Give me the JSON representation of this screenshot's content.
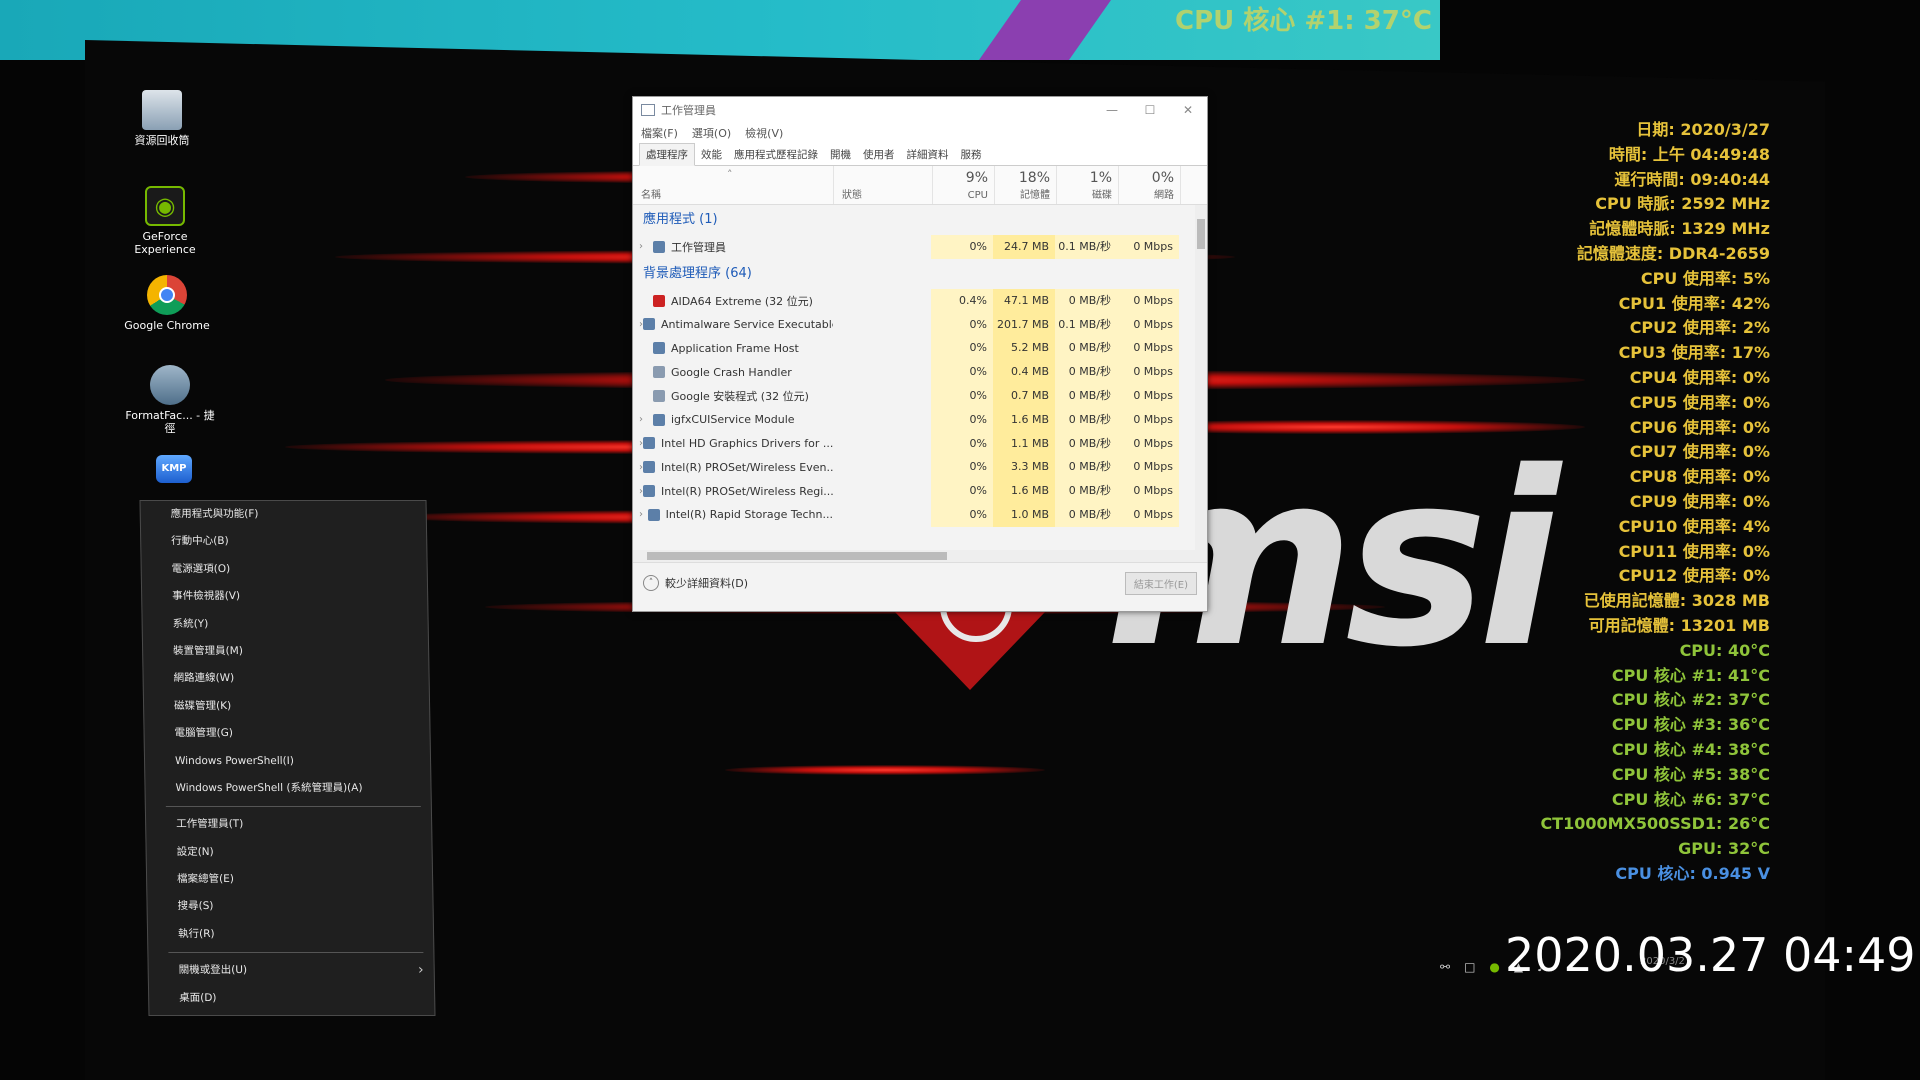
{
  "background_monitor": {
    "text": "CPU 核心 #1: 37°C"
  },
  "desktop_icons": [
    {
      "label": "資源回收筒",
      "icon": "recycle-bin-icon"
    },
    {
      "label": "GeForce Experience",
      "icon": "nvidia-icon"
    },
    {
      "label": "Google Chrome",
      "icon": "chrome-icon"
    },
    {
      "label": "FormatFac... - 捷徑",
      "icon": "format-factory-icon"
    },
    {
      "label": "KMP",
      "icon": "kmplayer-icon"
    }
  ],
  "task_manager": {
    "title": "工作管理員",
    "menu": [
      "檔案(F)",
      "選項(O)",
      "檢視(V)"
    ],
    "tabs": [
      "處理程序",
      "效能",
      "應用程式歷程記錄",
      "開機",
      "使用者",
      "詳細資料",
      "服務"
    ],
    "columns": {
      "name": "名稱",
      "status": "狀態",
      "cpu_pct": "9%",
      "cpu": "CPU",
      "mem_pct": "18%",
      "mem": "記憶體",
      "disk_pct": "1%",
      "disk": "磁碟",
      "net_pct": "0%",
      "net": "網路"
    },
    "group_apps": "應用程式 (1)",
    "group_bg": "背景處理程序 (64)",
    "app_rows": [
      {
        "name": "工作管理員",
        "cpu": "0%",
        "mem": "24.7 MB",
        "disk": "0.1 MB/秒",
        "net": "0 Mbps"
      }
    ],
    "bg_rows": [
      {
        "name": "AIDA64 Extreme (32 位元)",
        "cpu": "0.4%",
        "mem": "47.1 MB",
        "disk": "0 MB/秒",
        "net": "0 Mbps",
        "icon": "aida"
      },
      {
        "name": "Antimalware Service Executable",
        "cpu": "0%",
        "mem": "201.7 MB",
        "disk": "0.1 MB/秒",
        "net": "0 Mbps",
        "icon": "app"
      },
      {
        "name": "Application Frame Host",
        "cpu": "0%",
        "mem": "5.2 MB",
        "disk": "0 MB/秒",
        "net": "0 Mbps",
        "icon": "app"
      },
      {
        "name": "Google Crash Handler",
        "cpu": "0%",
        "mem": "0.4 MB",
        "disk": "0 MB/秒",
        "net": "0 Mbps",
        "icon": "google"
      },
      {
        "name": "Google 安裝程式 (32 位元)",
        "cpu": "0%",
        "mem": "0.7 MB",
        "disk": "0 MB/秒",
        "net": "0 Mbps",
        "icon": "google"
      },
      {
        "name": "igfxCUIService Module",
        "cpu": "0%",
        "mem": "1.6 MB",
        "disk": "0 MB/秒",
        "net": "0 Mbps",
        "icon": "app"
      },
      {
        "name": "Intel HD Graphics Drivers for ...",
        "cpu": "0%",
        "mem": "1.1 MB",
        "disk": "0 MB/秒",
        "net": "0 Mbps",
        "icon": "app"
      },
      {
        "name": "Intel(R) PROSet/Wireless Even...",
        "cpu": "0%",
        "mem": "3.3 MB",
        "disk": "0 MB/秒",
        "net": "0 Mbps",
        "icon": "app"
      },
      {
        "name": "Intel(R) PROSet/Wireless Regi...",
        "cpu": "0%",
        "mem": "1.6 MB",
        "disk": "0 MB/秒",
        "net": "0 Mbps",
        "icon": "app"
      },
      {
        "name": "Intel(R) Rapid Storage Techn...",
        "cpu": "0%",
        "mem": "1.0 MB",
        "disk": "0 MB/秒",
        "net": "0 Mbps",
        "icon": "app"
      }
    ],
    "fewer_details": "較少詳細資料(D)",
    "end_task": "結束工作(E)"
  },
  "winx_menu": {
    "section1": [
      "應用程式與功能(F)",
      "行動中心(B)",
      "電源選項(O)",
      "事件檢視器(V)",
      "系統(Y)",
      "裝置管理員(M)",
      "網路連線(W)",
      "磁碟管理(K)",
      "電腦管理(G)",
      "Windows PowerShell(I)",
      "Windows PowerShell (系統管理員)(A)"
    ],
    "section2": [
      "工作管理員(T)",
      "設定(N)",
      "檔案總管(E)",
      "搜尋(S)",
      "執行(R)"
    ],
    "section3": [
      "關機或登出(U)",
      "桌面(D)"
    ]
  },
  "sensors": [
    {
      "text": "日期: 2020/3/27",
      "color": "yellow"
    },
    {
      "text": "時間: 上午 04:49:48",
      "color": "yellow"
    },
    {
      "text": "運行時間: 09:40:44",
      "color": "yellow"
    },
    {
      "text": "CPU 時脈: 2592 MHz",
      "color": "yellow"
    },
    {
      "text": "記憶體時脈: 1329 MHz",
      "color": "yellow"
    },
    {
      "text": "記憶體速度: DDR4-2659",
      "color": "yellow"
    },
    {
      "text": "CPU 使用率: 5%",
      "color": "yellow"
    },
    {
      "text": "CPU1 使用率: 42%",
      "color": "yellow"
    },
    {
      "text": "CPU2 使用率: 2%",
      "color": "yellow"
    },
    {
      "text": "CPU3 使用率: 17%",
      "color": "yellow"
    },
    {
      "text": "CPU4 使用率: 0%",
      "color": "yellow"
    },
    {
      "text": "CPU5 使用率: 0%",
      "color": "yellow"
    },
    {
      "text": "CPU6 使用率: 0%",
      "color": "yellow"
    },
    {
      "text": "CPU7 使用率: 0%",
      "color": "yellow"
    },
    {
      "text": "CPU8 使用率: 0%",
      "color": "yellow"
    },
    {
      "text": "CPU9 使用率: 0%",
      "color": "yellow"
    },
    {
      "text": "CPU10 使用率: 4%",
      "color": "yellow"
    },
    {
      "text": "CPU11 使用率: 0%",
      "color": "yellow"
    },
    {
      "text": "CPU12 使用率: 0%",
      "color": "yellow"
    },
    {
      "text": "已使用記憶體: 3028 MB",
      "color": "yellow"
    },
    {
      "text": "可用記憶體: 13201 MB",
      "color": "yellow"
    },
    {
      "text": "CPU: 40°C",
      "color": "green"
    },
    {
      "text": "CPU 核心 #1: 41°C",
      "color": "green"
    },
    {
      "text": "CPU 核心 #2: 37°C",
      "color": "green"
    },
    {
      "text": "CPU 核心 #3: 36°C",
      "color": "green"
    },
    {
      "text": "CPU 核心 #4: 38°C",
      "color": "green"
    },
    {
      "text": "CPU 核心 #5: 38°C",
      "color": "green"
    },
    {
      "text": "CPU 核心 #6: 37°C",
      "color": "green"
    },
    {
      "text": "CT1000MX500SSD1: 26°C",
      "color": "green"
    },
    {
      "text": "GPU: 32°C",
      "color": "green"
    },
    {
      "text": "CPU 核心: 0.945 V",
      "color": "blue"
    }
  ],
  "tray_clock": "2020/3/27",
  "photo_timestamp": "2020.03.27 04:49"
}
